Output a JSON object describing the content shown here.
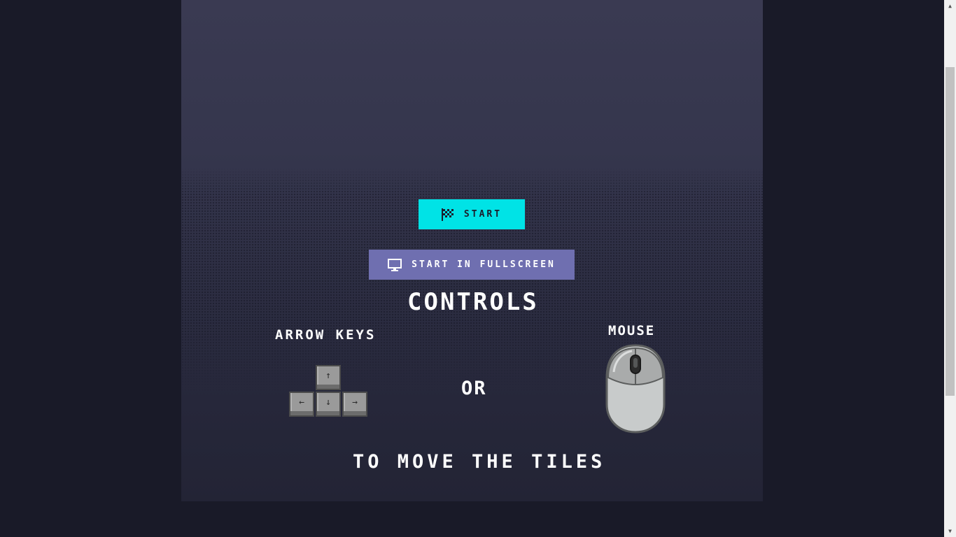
{
  "buttons": {
    "start_label": "start",
    "fullscreen_label": "start in fullscreen"
  },
  "controls": {
    "title": "CONTROLS",
    "arrow_keys_label": "ARROW KEYS",
    "mouse_label": "MOUSE",
    "or_label": "OR",
    "move_label": "TO MOVE THE TILES"
  },
  "keys": {
    "up": "↑",
    "left": "←",
    "down": "↓",
    "right": "→"
  },
  "icons": {
    "start": "checkered-flag-icon",
    "fullscreen": "monitor-icon",
    "keys": "arrow-keys-icon",
    "mouse": "mouse-icon"
  },
  "colors": {
    "start_button": "#00e3e6",
    "fullscreen_button": "#6f6fb0",
    "background": "#191a28",
    "panel": "#35364d"
  }
}
